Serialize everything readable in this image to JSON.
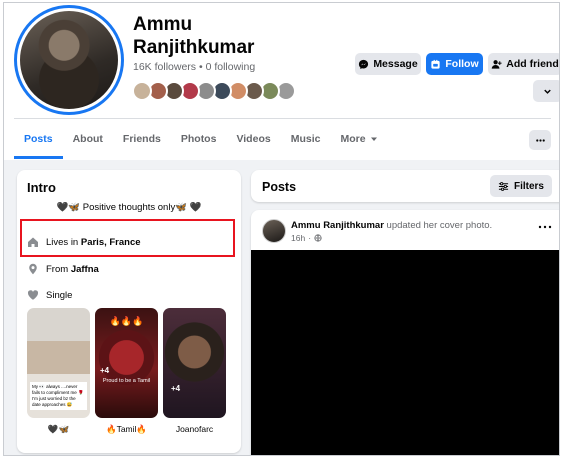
{
  "profile": {
    "name": "Ammu Ranjithkumar",
    "followers": "16K followers",
    "separator": "•",
    "following": "0 following",
    "friend_colors": [
      "#c7b29a",
      "#a35f4b",
      "#5a4a3d",
      "#b23a4a",
      "#8c8c8c",
      "#3c4a5a",
      "#d18d66",
      "#6b5a4c",
      "#7b8a5a",
      "#9a9a9a"
    ]
  },
  "actions": {
    "message_label": "Message",
    "follow_label": "Follow",
    "add_friend_label": "Add friend"
  },
  "tabs": [
    {
      "label": "Posts",
      "active": true
    },
    {
      "label": "About"
    },
    {
      "label": "Friends"
    },
    {
      "label": "Photos"
    },
    {
      "label": "Videos"
    },
    {
      "label": "Music"
    },
    {
      "label": "More"
    }
  ],
  "intro": {
    "title": "Intro",
    "bio": "🖤🦋 Positive thoughts only🦋 🖤",
    "lives_prefix": "Lives in",
    "lives_place": "Paris, France",
    "from_prefix": "From",
    "from_place": "Jaffna",
    "relationship": "Single",
    "photos": [
      {
        "caption": "🖤🦋",
        "overlay": "My 👀 always ....never fails to compliment me 🌹 I'm just worried bz the date approaches 😅"
      },
      {
        "caption": "🔥Tamil🔥",
        "overlay": "Proud to be a Tamil",
        "top": "🔥🔥🔥",
        "plus": "+4"
      },
      {
        "caption": "Joanofarc",
        "plus": "+4"
      }
    ]
  },
  "posts": {
    "title": "Posts",
    "filters_label": "Filters",
    "post_author": "Ammu Ranjithkumar",
    "post_action": "updated her cover photo.",
    "post_time": "16h",
    "post_time_separator": "·"
  },
  "colors": {
    "accent": "#1877f2",
    "highlight": "#e8141f"
  }
}
